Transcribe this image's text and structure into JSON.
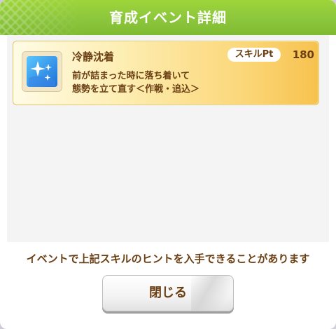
{
  "dialog": {
    "title": "育成イベント詳細"
  },
  "skill": {
    "name": "冷静沈着",
    "pt_label": "スキルPt",
    "pt_value": "180",
    "description": "前が詰まった時に落ち着いて\n態勢を立て直す＜作戦・追込＞",
    "icon": "sparkle-skill-icon",
    "icon_color": "#2d8be0"
  },
  "notice": "イベントで上記スキルのヒントを入手できることがあります",
  "buttons": {
    "close_label": "閉じる"
  },
  "colors": {
    "header": "#8cc63c",
    "text_brown": "#6b3f14",
    "card_gold": "#fbd77a"
  }
}
